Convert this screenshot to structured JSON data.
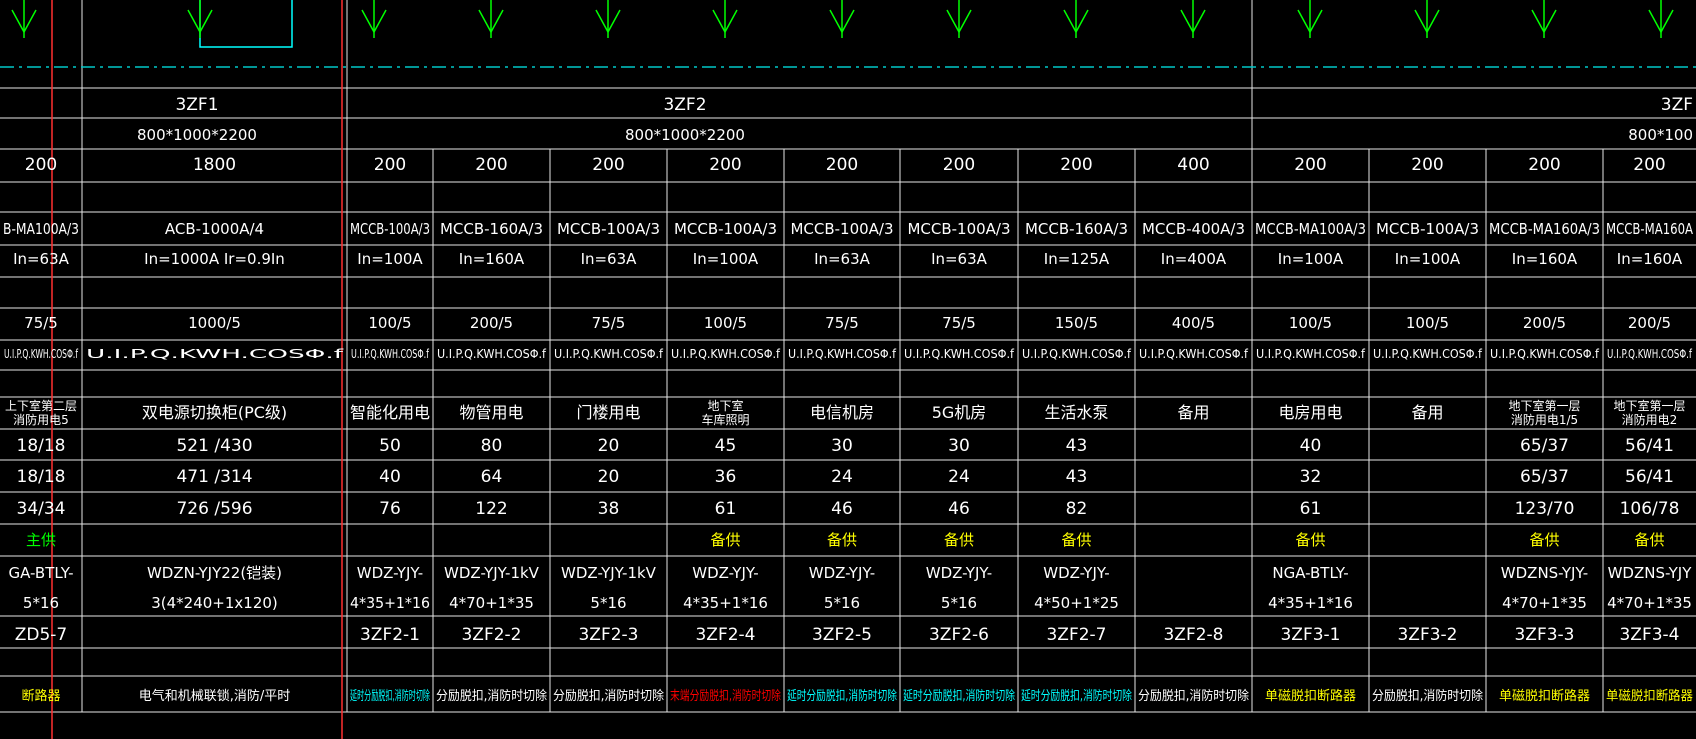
{
  "colors": {
    "background": "#000000",
    "grid": "#e6e6e6",
    "white_text": "#ffffff",
    "yellow": "#ffff00",
    "green": "#00ff00",
    "cyan": "#00ffff",
    "red": "#ff0000",
    "dashed_line": "#00c8c8",
    "vertical_red": "#ff3030"
  },
  "cabinets": [
    {
      "id": "3ZF1",
      "size": "800*1000*2200"
    },
    {
      "id": "3ZF2",
      "size": "800*1000*2200"
    },
    {
      "id": "3ZF",
      "size": "800*100"
    }
  ],
  "columns": [
    {
      "width": "200",
      "breaker": "B-MA100A/3",
      "rating": "In=63A",
      "ct": "75/5",
      "meter": "U.I.P.Q.KWH.COSΦ.f",
      "load": "上下室第二层",
      "load_line2": "消防用电5",
      "p1": "18/18",
      "p2": "18/18",
      "p3": "34/34",
      "supply": "主供",
      "supply_color": "green",
      "cable_line1": "GA-BTLY-",
      "cable_line2": "5*16",
      "circuit": "ZD5-7",
      "note": "断路器",
      "note_color": "yellow"
    },
    {
      "width": "1800",
      "breaker": "ACB-1000A/4",
      "rating": "In=1000A Ir=0.9In",
      "ct": "1000/5",
      "meter": "U.I.P.Q.KWH.COSΦ.f",
      "load": "双电源切换柜(PC级)",
      "load_line2": "",
      "p1": "521 /430",
      "p2": "471 /314",
      "p3": "726 /596",
      "supply": "",
      "supply_color": "yellow",
      "cable_line1": "WDZN-YJY22(铠装)",
      "cable_line2": "3(4*240+1x120)",
      "circuit": "",
      "note": "电气和机械联锁,消防/平时",
      "note_color": "white"
    },
    {
      "width": "200",
      "breaker": "MCCB-100A/3",
      "rating": "In=100A",
      "ct": "100/5",
      "meter": "U.I.P.Q.KWH.COSΦ.f",
      "load": "智能化用电",
      "load_line2": "",
      "p1": "50",
      "p2": "40",
      "p3": "76",
      "supply": "",
      "supply_color": "yellow",
      "cable_line1": "WDZ-YJY-",
      "cable_line2": "4*35+1*16",
      "circuit": "3ZF2-1",
      "note": "延时分励脱扣,消防时切除",
      "note_color": "cyan"
    },
    {
      "width": "200",
      "breaker": "MCCB-160A/3",
      "rating": "In=160A",
      "ct": "200/5",
      "meter": "U.I.P.Q.KWH.COSΦ.f",
      "load": "物管用电",
      "load_line2": "",
      "p1": "80",
      "p2": "64",
      "p3": "122",
      "supply": "",
      "supply_color": "yellow",
      "cable_line1": "WDZ-YJY-1kV",
      "cable_line2": "4*70+1*35",
      "circuit": "3ZF2-2",
      "note": "分励脱扣,消防时切除",
      "note_color": "white"
    },
    {
      "width": "200",
      "breaker": "MCCB-100A/3",
      "rating": "In=63A",
      "ct": "75/5",
      "meter": "U.I.P.Q.KWH.COSΦ.f",
      "load": "门楼用电",
      "load_line2": "",
      "p1": "20",
      "p2": "20",
      "p3": "38",
      "supply": "",
      "supply_color": "yellow",
      "cable_line1": "WDZ-YJY-1kV",
      "cable_line2": "5*16",
      "circuit": "3ZF2-3",
      "note": "分励脱扣,消防时切除",
      "note_color": "white"
    },
    {
      "width": "200",
      "breaker": "MCCB-100A/3",
      "rating": "In=100A",
      "ct": "100/5",
      "meter": "U.I.P.Q.KWH.COSΦ.f",
      "load": "地下室",
      "load_line2": "车库照明",
      "p1": "45",
      "p2": "36",
      "p3": "61",
      "supply": "备供",
      "supply_color": "yellow",
      "cable_line1": "WDZ-YJY-",
      "cable_line2": "4*35+1*16",
      "circuit": "3ZF2-4",
      "note": "末端分励脱扣,消防时切除",
      "note_color": "red"
    },
    {
      "width": "200",
      "breaker": "MCCB-100A/3",
      "rating": "In=63A",
      "ct": "75/5",
      "meter": "U.I.P.Q.KWH.COSΦ.f",
      "load": "电信机房",
      "load_line2": "",
      "p1": "30",
      "p2": "24",
      "p3": "46",
      "supply": "备供",
      "supply_color": "yellow",
      "cable_line1": "WDZ-YJY-",
      "cable_line2": "5*16",
      "circuit": "3ZF2-5",
      "note": "延时分励脱扣,消防时切除",
      "note_color": "cyan"
    },
    {
      "width": "200",
      "breaker": "MCCB-100A/3",
      "rating": "In=63A",
      "ct": "75/5",
      "meter": "U.I.P.Q.KWH.COSΦ.f",
      "load": "5G机房",
      "load_line2": "",
      "p1": "30",
      "p2": "24",
      "p3": "46",
      "supply": "备供",
      "supply_color": "yellow",
      "cable_line1": "WDZ-YJY-",
      "cable_line2": "5*16",
      "circuit": "3ZF2-6",
      "note": "延时分励脱扣,消防时切除",
      "note_color": "cyan"
    },
    {
      "width": "200",
      "breaker": "MCCB-160A/3",
      "rating": "In=125A",
      "ct": "150/5",
      "meter": "U.I.P.Q.KWH.COSΦ.f",
      "load": "生活水泵",
      "load_line2": "",
      "p1": "43",
      "p2": "43",
      "p3": "82",
      "supply": "备供",
      "supply_color": "yellow",
      "cable_line1": "WDZ-YJY-",
      "cable_line2": "4*50+1*25",
      "circuit": "3ZF2-7",
      "note": "延时分励脱扣,消防时切除",
      "note_color": "cyan"
    },
    {
      "width": "400",
      "breaker": "MCCB-400A/3",
      "rating": "In=400A",
      "ct": "400/5",
      "meter": "U.I.P.Q.KWH.COSΦ.f",
      "load": "备用",
      "load_line2": "",
      "p1": "",
      "p2": "",
      "p3": "",
      "supply": "",
      "supply_color": "yellow",
      "cable_line1": "",
      "cable_line2": "",
      "circuit": "3ZF2-8",
      "note": "分励脱扣,消防时切除",
      "note_color": "white"
    },
    {
      "width": "200",
      "breaker": "MCCB-MA100A/3",
      "rating": "In=100A",
      "ct": "100/5",
      "meter": "U.I.P.Q.KWH.COSΦ.f",
      "load": "电房用电",
      "load_line2": "",
      "p1": "40",
      "p2": "32",
      "p3": "61",
      "supply": "备供",
      "supply_color": "yellow",
      "cable_line1": "NGA-BTLY-",
      "cable_line2": "4*35+1*16",
      "circuit": "3ZF3-1",
      "note": "单磁脱扣断路器",
      "note_color": "yellow"
    },
    {
      "width": "200",
      "breaker": "MCCB-100A/3",
      "rating": "In=100A",
      "ct": "100/5",
      "meter": "U.I.P.Q.KWH.COSΦ.f",
      "load": "备用",
      "load_line2": "",
      "p1": "",
      "p2": "",
      "p3": "",
      "supply": "",
      "supply_color": "yellow",
      "cable_line1": "",
      "cable_line2": "",
      "circuit": "3ZF3-2",
      "note": "分励脱扣,消防时切除",
      "note_color": "white"
    },
    {
      "width": "200",
      "breaker": "MCCB-MA160A/3",
      "rating": "In=160A",
      "ct": "200/5",
      "meter": "U.I.P.Q.KWH.COSΦ.f",
      "load": "地下室第一层",
      "load_line2": "消防用电1/5",
      "p1": "65/37",
      "p2": "65/37",
      "p3": "123/70",
      "supply": "备供",
      "supply_color": "yellow",
      "cable_line1": "WDZNS-YJY-",
      "cable_line2": "4*70+1*35",
      "circuit": "3ZF3-3",
      "note": "单磁脱扣断路器",
      "note_color": "yellow"
    },
    {
      "width": "200",
      "breaker": "MCCB-MA160A",
      "rating": "In=160A",
      "ct": "200/5",
      "meter": "U.I.P.Q.KWH.COSΦ.f",
      "load": "地下室第一层",
      "load_line2": "消防用电2",
      "p1": "56/41",
      "p2": "56/41",
      "p3": "106/78",
      "supply": "备供",
      "supply_color": "yellow",
      "cable_line1": "WDZNS-YJY",
      "cable_line2": "4*70+1*35",
      "circuit": "3ZF3-4",
      "note": "单磁脱扣断路器",
      "note_color": "yellow"
    }
  ]
}
